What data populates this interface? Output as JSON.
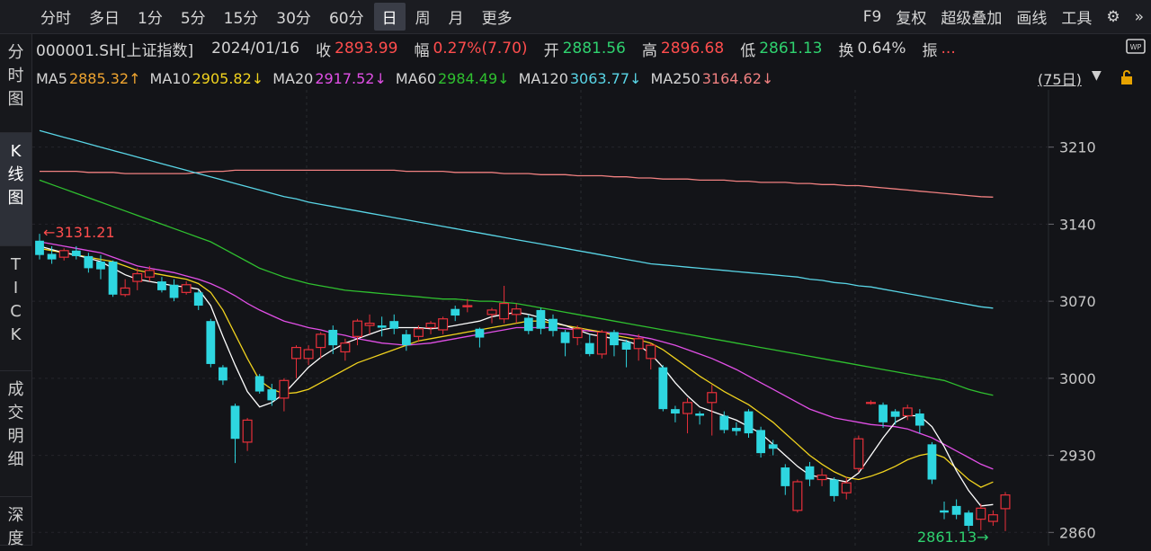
{
  "toolbar": {
    "left": [
      "分时",
      "多日",
      "1分",
      "5分",
      "15分",
      "30分",
      "60分",
      "日",
      "周",
      "月",
      "更多"
    ],
    "active": "日",
    "right": [
      "F9",
      "复权",
      "超级叠加",
      "画线",
      "工具"
    ]
  },
  "sidebar": {
    "items": [
      {
        "label": "分时图",
        "active": false
      },
      {
        "label": "K线图",
        "active": true
      },
      {
        "label": "TICK",
        "active": false
      },
      {
        "label": "成交明细",
        "active": false
      },
      {
        "label": "深度",
        "active": false
      }
    ]
  },
  "info": {
    "code": "000001.SH[上证指数]",
    "date": "2024/01/16",
    "close_label": "收",
    "close": "2893.99",
    "change_label": "幅",
    "change": "0.27%(7.70)",
    "open_label": "开",
    "open": "2881.56",
    "high_label": "高",
    "high": "2896.68",
    "low_label": "低",
    "low": "2861.13",
    "turnover_label": "换",
    "turnover": "0.64%",
    "amp_label": "振",
    "amp": "..."
  },
  "ma_legend": {
    "ma5": "MA5",
    "ma5_val": "2885.32↑",
    "ma10": "MA10",
    "ma10_val": "2905.82↓",
    "ma20": "MA20",
    "ma20_val": "2917.52↓",
    "ma60": "MA60",
    "ma60_val": "2984.49↓",
    "ma120": "MA120",
    "ma120_val": "3063.77↓",
    "ma250": "MA250",
    "ma250_val": "3164.62↓"
  },
  "period_label": "(75日)",
  "colors": {
    "up": "#e8303a",
    "down": "#2ed6e0",
    "ma5": "#ffffff",
    "ma10": "#f0d21e",
    "ma20": "#e14fe6",
    "ma60": "#2fc02f",
    "ma120": "#59d5e6",
    "ma250": "#f08080"
  },
  "chart_data": {
    "type": "candlestick",
    "ylim": [
      2848,
      3262
    ],
    "y_ticks": [
      3210,
      3140,
      3070,
      3000,
      2930,
      2860
    ],
    "max_annotation": "3131.21",
    "min_annotation": "2861.13",
    "candles": [
      [
        3125,
        3112,
        3131.21,
        3108
      ],
      [
        3113,
        3108,
        3120,
        3104
      ],
      [
        3110,
        3116,
        3118,
        3107
      ],
      [
        3116,
        3111,
        3120,
        3108
      ],
      [
        3111,
        3100,
        3114,
        3096
      ],
      [
        3106,
        3099,
        3112,
        3090
      ],
      [
        3106,
        3076,
        3107,
        3074
      ],
      [
        3076,
        3082,
        3090,
        3074
      ],
      [
        3088,
        3095,
        3100,
        3080
      ],
      [
        3092,
        3098,
        3102,
        3088
      ],
      [
        3088,
        3080,
        3092,
        3078
      ],
      [
        3085,
        3073,
        3090,
        3070
      ],
      [
        3078,
        3085,
        3088,
        3076
      ],
      [
        3078,
        3066,
        3080,
        3062
      ],
      [
        3052,
        3013,
        3054,
        3010
      ],
      [
        3010,
        2998,
        3012,
        2994
      ],
      [
        2975,
        2945,
        2977,
        2923
      ],
      [
        2942,
        2962,
        2964,
        2934
      ],
      [
        3002,
        2988,
        3004,
        2986
      ],
      [
        2990,
        2980,
        2995,
        2975
      ],
      [
        2982,
        2998,
        3000,
        2970
      ],
      [
        3018,
        3028,
        3030,
        3000
      ],
      [
        3018,
        3026,
        3030,
        3012
      ],
      [
        3028,
        3040,
        3042,
        3018
      ],
      [
        3044,
        3030,
        3048,
        3022
      ],
      [
        3024,
        3032,
        3036,
        3016
      ],
      [
        3038,
        3052,
        3054,
        3030
      ],
      [
        3048,
        3050,
        3058,
        3040
      ],
      [
        3048,
        3046,
        3056,
        3038
      ],
      [
        3052,
        3045,
        3058,
        3040
      ],
      [
        3040,
        3030,
        3044,
        3025
      ],
      [
        3038,
        3045,
        3048,
        3033
      ],
      [
        3046,
        3050,
        3052,
        3040
      ],
      [
        3044,
        3054,
        3056,
        3040
      ],
      [
        3063,
        3057,
        3066,
        3052
      ],
      [
        3065,
        3066,
        3072,
        3060
      ],
      [
        3045,
        3037,
        3046,
        3028
      ],
      [
        3058,
        3062,
        3064,
        3050
      ],
      [
        3054,
        3068,
        3084,
        3050
      ],
      [
        3058,
        3063,
        3068,
        3050
      ],
      [
        3055,
        3043,
        3058,
        3040
      ],
      [
        3062,
        3045,
        3064,
        3040
      ],
      [
        3054,
        3043,
        3058,
        3038
      ],
      [
        3042,
        3032,
        3044,
        3020
      ],
      [
        3037,
        3045,
        3048,
        3030
      ],
      [
        3032,
        3022,
        3040,
        3020
      ],
      [
        3022,
        3042,
        3044,
        3018
      ],
      [
        3042,
        3030,
        3044,
        3020
      ],
      [
        3033,
        3026,
        3035,
        3010
      ],
      [
        3027,
        3036,
        3040,
        3016
      ],
      [
        3018,
        3030,
        3032,
        3008
      ],
      [
        3010,
        2972,
        3012,
        2970
      ],
      [
        2972,
        2968,
        2975,
        2960
      ],
      [
        2968,
        2978,
        2982,
        2950
      ],
      [
        2968,
        2966,
        2970,
        2958
      ],
      [
        2978,
        2987,
        2994,
        2948
      ],
      [
        2966,
        2953,
        2970,
        2950
      ],
      [
        2955,
        2952,
        2960,
        2948
      ],
      [
        2970,
        2950,
        2972,
        2946
      ],
      [
        2953,
        2932,
        2956,
        2928
      ],
      [
        2940,
        2936,
        2944,
        2930
      ],
      [
        2919,
        2902,
        2922,
        2894
      ],
      [
        2880,
        2906,
        2908,
        2878
      ],
      [
        2920,
        2908,
        2924,
        2902
      ],
      [
        2908,
        2912,
        2918,
        2902
      ],
      [
        2908,
        2893,
        2910,
        2888
      ],
      [
        2896,
        2905,
        2910,
        2890
      ],
      [
        2918,
        2945,
        2948,
        2915
      ],
      [
        2978,
        2978,
        2980,
        2976
      ],
      [
        2976,
        2960,
        2978,
        2955
      ],
      [
        2970,
        2965,
        2972,
        2958
      ],
      [
        2966,
        2973,
        2976,
        2962
      ],
      [
        2968,
        2957,
        2972,
        2950
      ],
      [
        2940,
        2908,
        2942,
        2904
      ],
      [
        2880,
        2878,
        2888,
        2872
      ],
      [
        2884,
        2876,
        2890,
        2872
      ],
      [
        2878,
        2866,
        2880,
        2861.13
      ],
      [
        2872,
        2882,
        2886,
        2862
      ],
      [
        2870,
        2876,
        2880,
        2866
      ],
      [
        2881.56,
        2893.99,
        2896.68,
        2861.13
      ]
    ],
    "ma_series": [
      {
        "key": "ma250",
        "color": "#f08080",
        "start": 0,
        "values": [
          3188,
          3188,
          3188,
          3188,
          3187,
          3187,
          3187,
          3186,
          3186,
          3186,
          3186,
          3186,
          3186,
          3187,
          3188,
          3188,
          3189,
          3189,
          3189,
          3189,
          3189,
          3189,
          3189,
          3189,
          3189,
          3189,
          3189,
          3189,
          3189,
          3189,
          3188,
          3188,
          3188,
          3188,
          3187,
          3187,
          3187,
          3187,
          3186,
          3186,
          3186,
          3185,
          3185,
          3185,
          3184,
          3184,
          3184,
          3183,
          3183,
          3182,
          3182,
          3181,
          3181,
          3181,
          3180,
          3180,
          3180,
          3179,
          3179,
          3178,
          3178,
          3178,
          3177,
          3177,
          3176,
          3176,
          3175,
          3175,
          3174,
          3173,
          3172,
          3171,
          3170,
          3169,
          3168,
          3167,
          3166,
          3165,
          3164.62
        ]
      },
      {
        "key": "ma120",
        "color": "#59d5e6",
        "start": 0,
        "values": [
          3225,
          3222,
          3219,
          3216,
          3213,
          3210,
          3207,
          3204,
          3201,
          3198,
          3195,
          3192,
          3189,
          3186,
          3183,
          3180,
          3177,
          3174,
          3171,
          3168,
          3165,
          3163,
          3160,
          3158,
          3156,
          3154,
          3152,
          3150,
          3148,
          3146,
          3144,
          3142,
          3140,
          3138,
          3136,
          3134,
          3132,
          3130,
          3128,
          3126,
          3124,
          3122,
          3120,
          3118,
          3116,
          3114,
          3112,
          3110,
          3108,
          3106,
          3104,
          3103,
          3102,
          3101,
          3100,
          3099,
          3098,
          3097,
          3096,
          3095,
          3094,
          3093,
          3092,
          3090,
          3089,
          3087,
          3086,
          3084,
          3083,
          3081,
          3079,
          3077,
          3075,
          3073,
          3071,
          3069,
          3067,
          3065,
          3063.77
        ]
      },
      {
        "key": "ma60",
        "color": "#2fc02f",
        "start": 0,
        "values": [
          3180,
          3176,
          3172,
          3168,
          3164,
          3160,
          3156,
          3152,
          3148,
          3144,
          3140,
          3136,
          3132,
          3128,
          3124,
          3118,
          3112,
          3106,
          3100,
          3096,
          3092,
          3089,
          3086,
          3084,
          3082,
          3080,
          3079,
          3078,
          3077,
          3076,
          3075,
          3074,
          3073,
          3072,
          3072,
          3071,
          3070,
          3070,
          3069,
          3068,
          3066,
          3064,
          3062,
          3060,
          3058,
          3056,
          3054,
          3052,
          3050,
          3048,
          3046,
          3044,
          3042,
          3040,
          3038,
          3036,
          3034,
          3032,
          3030,
          3028,
          3026,
          3024,
          3022,
          3020,
          3018,
          3016,
          3014,
          3012,
          3010,
          3008,
          3006,
          3004,
          3002,
          3000,
          2998,
          2994,
          2990,
          2987,
          2984.49
        ]
      },
      {
        "key": "ma20",
        "color": "#e14fe6",
        "start": 0,
        "values": [
          3124,
          3122,
          3120,
          3118,
          3116,
          3114,
          3110,
          3106,
          3102,
          3100,
          3098,
          3096,
          3093,
          3090,
          3086,
          3081,
          3075,
          3068,
          3062,
          3057,
          3052,
          3049,
          3046,
          3044,
          3041,
          3039,
          3036,
          3034,
          3032,
          3031,
          3030,
          3031,
          3032,
          3034,
          3036,
          3038,
          3040,
          3042,
          3044,
          3046,
          3046,
          3046,
          3046,
          3045,
          3044,
          3043,
          3042,
          3041,
          3040,
          3038,
          3036,
          3033,
          3030,
          3026,
          3022,
          3018,
          3013,
          3008,
          3002,
          2996,
          2990,
          2984,
          2978,
          2972,
          2968,
          2964,
          2962,
          2960,
          2958,
          2957,
          2956,
          2954,
          2950,
          2946,
          2940,
          2934,
          2928,
          2922,
          2917.52
        ]
      },
      {
        "key": "ma10",
        "color": "#f0d21e",
        "start": 0,
        "values": [
          3118,
          3116,
          3114,
          3112,
          3110,
          3108,
          3106,
          3102,
          3098,
          3096,
          3094,
          3092,
          3090,
          3086,
          3078,
          3062,
          3040,
          3018,
          2998,
          2990,
          2986,
          2987,
          2990,
          2996,
          3002,
          3008,
          3014,
          3018,
          3022,
          3026,
          3030,
          3034,
          3036,
          3038,
          3040,
          3042,
          3044,
          3046,
          3048,
          3050,
          3052,
          3052,
          3050,
          3048,
          3046,
          3044,
          3042,
          3039,
          3037,
          3035,
          3032,
          3026,
          3018,
          3010,
          3002,
          2995,
          2988,
          2982,
          2976,
          2968,
          2960,
          2950,
          2940,
          2930,
          2922,
          2915,
          2910,
          2908,
          2911,
          2915,
          2920,
          2926,
          2930,
          2932,
          2928,
          2918,
          2908,
          2901,
          2905.82
        ]
      },
      {
        "key": "ma5",
        "color": "#ffffff",
        "start": 0,
        "values": [
          3120,
          3117,
          3114,
          3112,
          3109,
          3106,
          3100,
          3094,
          3090,
          3088,
          3086,
          3084,
          3083,
          3081,
          3066,
          3038,
          3012,
          2988,
          2974,
          2978,
          2986,
          2998,
          3010,
          3019,
          3026,
          3032,
          3036,
          3040,
          3044,
          3046,
          3046,
          3046,
          3045,
          3046,
          3048,
          3050,
          3052,
          3056,
          3058,
          3060,
          3058,
          3055,
          3051,
          3048,
          3044,
          3040,
          3038,
          3036,
          3034,
          3030,
          3022,
          3010,
          2996,
          2984,
          2974,
          2970,
          2966,
          2962,
          2956,
          2950,
          2940,
          2930,
          2920,
          2912,
          2910,
          2908,
          2906,
          2914,
          2930,
          2946,
          2960,
          2966,
          2966,
          2956,
          2938,
          2916,
          2898,
          2884,
          2885.32
        ]
      }
    ]
  }
}
